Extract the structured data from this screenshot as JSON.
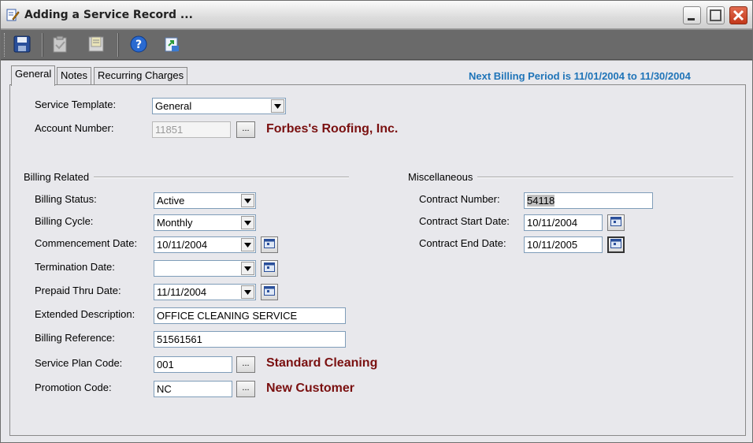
{
  "window": {
    "title": "Adding a Service Record ..."
  },
  "toolbar": {
    "save": "save-icon",
    "tool2": "clipboard-icon",
    "tool3": "notes-icon",
    "help": "help-icon",
    "export": "export-icon"
  },
  "tabs": [
    {
      "label": "General"
    },
    {
      "label": "Notes"
    },
    {
      "label": "Recurring Charges"
    }
  ],
  "next_billing": "Next Billing Period is 11/01/2004 to 11/30/2004",
  "top": {
    "service_template_label": "Service Template:",
    "service_template_value": "General",
    "account_number_label": "Account Number:",
    "account_number_value": "11851",
    "account_name": "Forbes's Roofing, Inc.",
    "browse": "..."
  },
  "billing": {
    "group_title": "Billing Related",
    "status_label": "Billing Status:",
    "status_value": "Active",
    "cycle_label": "Billing Cycle:",
    "cycle_value": "Monthly",
    "commencement_label": "Commencement Date:",
    "commencement_value": "10/11/2004",
    "termination_label": "Termination Date:",
    "termination_value": "",
    "prepaid_label": "Prepaid Thru Date:",
    "prepaid_value": "11/11/2004",
    "ext_desc_label": "Extended Description:",
    "ext_desc_value": "OFFICE CLEANING SERVICE",
    "reference_label": "Billing Reference:",
    "reference_value": "51561561",
    "plan_label": "Service Plan Code:",
    "plan_value": "001",
    "plan_desc": "Standard Cleaning",
    "promo_label": "Promotion Code:",
    "promo_value": "NC",
    "promo_desc": "New Customer",
    "browse": "..."
  },
  "misc": {
    "group_title": "Miscellaneous",
    "contract_number_label": "Contract Number:",
    "contract_number_value": "54118",
    "start_label": "Contract Start Date:",
    "start_value": "10/11/2004",
    "end_label": "Contract End Date:",
    "end_value": "10/11/2005"
  },
  "colors": {
    "accent_blue": "#1f74b8",
    "desc_red": "#7a1010"
  }
}
